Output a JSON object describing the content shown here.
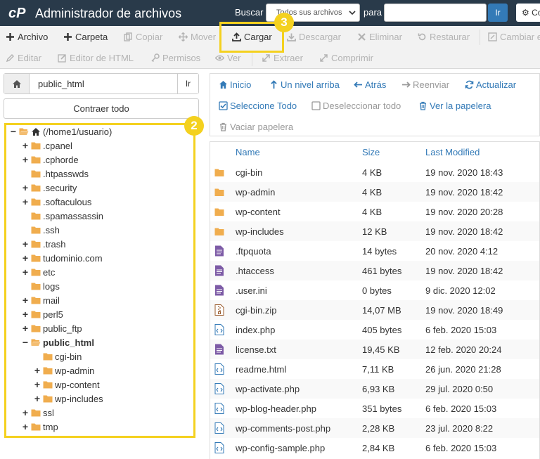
{
  "header": {
    "title": "Administrador de archivos",
    "search_label": "Buscar",
    "search_scope": "Todos sus archivos",
    "para_label": "para",
    "search_value": "",
    "go_label": "Ir",
    "settings_label": "Co"
  },
  "toolbar": {
    "row1": [
      {
        "label": "Archivo",
        "icon": "plus-icon",
        "enabled": true
      },
      {
        "label": "Carpeta",
        "icon": "plus-icon",
        "enabled": true
      },
      {
        "label": "Copiar",
        "icon": "copy-icon",
        "enabled": false
      },
      {
        "label": "Mover",
        "icon": "move-icon",
        "enabled": false
      },
      {
        "label": "Cargar",
        "icon": "upload-icon",
        "enabled": true
      },
      {
        "label": "Descargar",
        "icon": "download-icon",
        "enabled": false
      },
      {
        "label": "Eliminar",
        "icon": "delete-icon",
        "enabled": false
      },
      {
        "label": "Restaurar",
        "icon": "restore-icon",
        "enabled": false
      },
      {
        "label": "Cambiar e",
        "icon": "rename-icon",
        "enabled": false
      }
    ],
    "row2": [
      {
        "label": "Editar",
        "icon": "pencil-icon",
        "enabled": false
      },
      {
        "label": "Editor de HTML",
        "icon": "html-edit-icon",
        "enabled": false
      },
      {
        "label": "Permisos",
        "icon": "key-icon",
        "enabled": false
      },
      {
        "label": "Ver",
        "icon": "eye-icon",
        "enabled": false
      },
      {
        "label": "Extraer",
        "icon": "extract-icon",
        "enabled": false
      },
      {
        "label": "Comprimir",
        "icon": "compress-icon",
        "enabled": false
      }
    ]
  },
  "annotations": {
    "badge_2": "2",
    "badge_3": "3"
  },
  "left": {
    "path_value": "public_html",
    "path_go_label": "Ir",
    "collapse_label": "Contraer todo",
    "tree": [
      {
        "label": "(/home1/usuario)",
        "toggle": "−",
        "level": 0,
        "home": true
      },
      {
        "label": ".cpanel",
        "toggle": "+",
        "level": 1
      },
      {
        "label": ".cphorde",
        "toggle": "+",
        "level": 1
      },
      {
        "label": ".htpasswds",
        "toggle": "",
        "level": 1
      },
      {
        "label": ".security",
        "toggle": "+",
        "level": 1
      },
      {
        "label": ".softaculous",
        "toggle": "+",
        "level": 1
      },
      {
        "label": ".spamassassin",
        "toggle": "",
        "level": 1
      },
      {
        "label": ".ssh",
        "toggle": "",
        "level": 1
      },
      {
        "label": ".trash",
        "toggle": "+",
        "level": 1
      },
      {
        "label": "tudominio.com",
        "toggle": "+",
        "level": 1
      },
      {
        "label": "etc",
        "toggle": "+",
        "level": 1
      },
      {
        "label": "logs",
        "toggle": "",
        "level": 1
      },
      {
        "label": "mail",
        "toggle": "+",
        "level": 1
      },
      {
        "label": "perl5",
        "toggle": "+",
        "level": 1
      },
      {
        "label": "public_ftp",
        "toggle": "+",
        "level": 1
      },
      {
        "label": "public_html",
        "toggle": "−",
        "level": 1,
        "bold": true
      },
      {
        "label": "cgi-bin",
        "toggle": "",
        "level": 2
      },
      {
        "label": "wp-admin",
        "toggle": "+",
        "level": 2
      },
      {
        "label": "wp-content",
        "toggle": "+",
        "level": 2
      },
      {
        "label": "wp-includes",
        "toggle": "+",
        "level": 2
      },
      {
        "label": "ssl",
        "toggle": "+",
        "level": 1
      },
      {
        "label": "tmp",
        "toggle": "+",
        "level": 1
      }
    ]
  },
  "actions": {
    "home": "Inicio",
    "up": "Un nivel arriba",
    "back": "Atrás",
    "forward": "Reenviar",
    "refresh": "Actualizar",
    "select_all": "Seleccione Todo",
    "deselect_all": "Deseleccionar todo",
    "view_trash": "Ver la papelera",
    "empty_trash": "Vaciar papelera"
  },
  "table": {
    "columns": [
      "Name",
      "Size",
      "Last Modified"
    ],
    "rows": [
      {
        "icon": "folder-icon",
        "name": "cgi-bin",
        "size": "4 KB",
        "modified": "19 nov. 2020 18:43"
      },
      {
        "icon": "folder-icon",
        "name": "wp-admin",
        "size": "4 KB",
        "modified": "19 nov. 2020 18:42"
      },
      {
        "icon": "folder-icon",
        "name": "wp-content",
        "size": "4 KB",
        "modified": "19 nov. 2020 20:28"
      },
      {
        "icon": "folder-icon",
        "name": "wp-includes",
        "size": "12 KB",
        "modified": "19 nov. 2020 18:42"
      },
      {
        "icon": "text-file-icon",
        "name": ".ftpquota",
        "size": "14 bytes",
        "modified": "20 nov. 2020 4:12"
      },
      {
        "icon": "text-file-icon",
        "name": ".htaccess",
        "size": "461 bytes",
        "modified": "19 nov. 2020 18:42"
      },
      {
        "icon": "text-file-icon",
        "name": ".user.ini",
        "size": "0 bytes",
        "modified": "9 dic. 2020 12:02"
      },
      {
        "icon": "zip-file-icon",
        "name": "cgi-bin.zip",
        "size": "14,07 MB",
        "modified": "19 nov. 2020 18:49"
      },
      {
        "icon": "code-file-icon",
        "name": "index.php",
        "size": "405 bytes",
        "modified": "6 feb. 2020 15:03"
      },
      {
        "icon": "text-file-icon",
        "name": "license.txt",
        "size": "19,45 KB",
        "modified": "12 feb. 2020 20:24"
      },
      {
        "icon": "code-file-icon",
        "name": "readme.html",
        "size": "7,11 KB",
        "modified": "26 jun. 2020 21:28"
      },
      {
        "icon": "code-file-icon",
        "name": "wp-activate.php",
        "size": "6,93 KB",
        "modified": "29 jul. 2020 0:50"
      },
      {
        "icon": "code-file-icon",
        "name": "wp-blog-header.php",
        "size": "351 bytes",
        "modified": "6 feb. 2020 15:03"
      },
      {
        "icon": "code-file-icon",
        "name": "wp-comments-post.php",
        "size": "2,28 KB",
        "modified": "23 jul. 2020 8:22"
      },
      {
        "icon": "code-file-icon",
        "name": "wp-config-sample.php",
        "size": "2,84 KB",
        "modified": "6 feb. 2020 15:03"
      }
    ]
  },
  "colors": {
    "header_bg": "#293a4a",
    "accent": "#337ab7",
    "highlight": "#f4d11f",
    "folder": "#f0ad4e",
    "text_file": "#7d5ba6"
  }
}
